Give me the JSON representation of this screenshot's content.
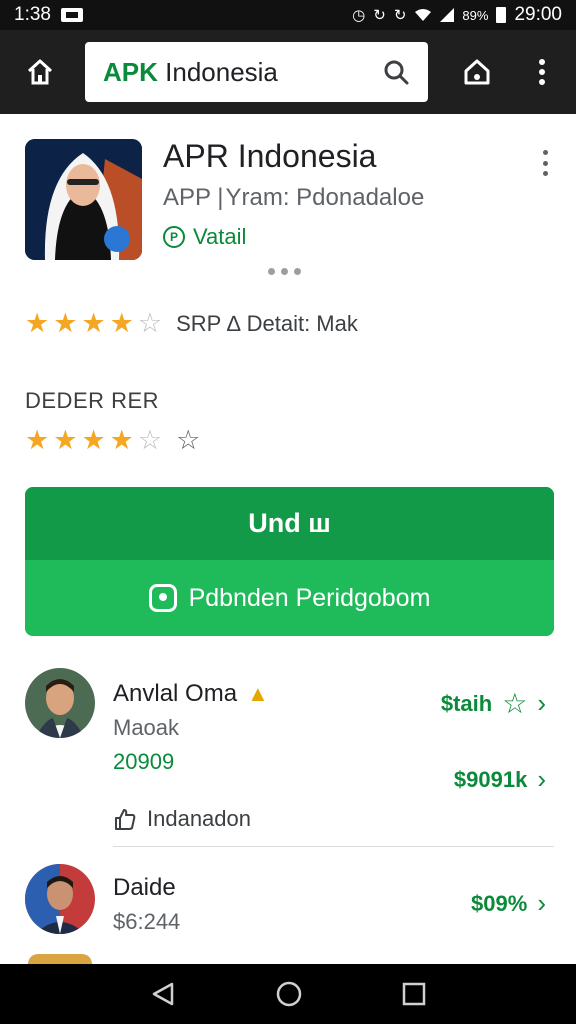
{
  "status_bar": {
    "left_time": "1:38",
    "clock": "29:00",
    "battery_text": "89%"
  },
  "top_bar": {
    "search": {
      "accent_text": "APK",
      "rest_text": " Indonesia"
    }
  },
  "app": {
    "title": "APR Indonesia",
    "subtitle": "APP  | Yram: Pdonadaloe",
    "verified_label": "Vatail",
    "rating_detail": "SRP ∆ Detait:  Mak",
    "rating_1": 4,
    "section_label": "DEDER RER",
    "rating_2": 4
  },
  "actions": {
    "install_label": "Und ш",
    "secondary_label": "Pdbnden Peridgobom"
  },
  "list": [
    {
      "name": "Anvlal Oma",
      "sub": "Maoak",
      "number": "20909",
      "price_top": "$taih",
      "price_bottom": "$9091k",
      "like_label": "Indanadon"
    },
    {
      "name": "Daide",
      "sub": "$6:244",
      "price_top": "$09%"
    }
  ],
  "colors": {
    "accent_green": "#0a8a3a",
    "install_green": "#139a48",
    "secondary_green": "#1fbb5a",
    "star": "#f5a623"
  },
  "icons": [
    "home-icon",
    "search-icon",
    "home-outline-icon",
    "more-vert-icon",
    "chat-icon",
    "thumb-up-icon",
    "chevron-right-icon",
    "back-triangle-icon",
    "home-circle-icon",
    "recents-square-icon"
  ]
}
